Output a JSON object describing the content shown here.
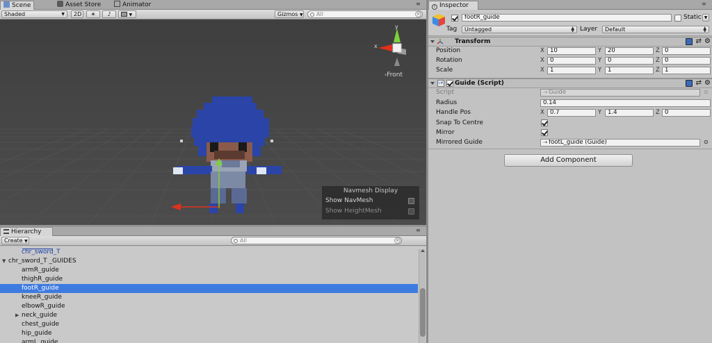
{
  "scene_tabs": {
    "scene": "Scene",
    "asset_store": "Asset Store",
    "animator": "Animator"
  },
  "scene_toolbar": {
    "draw_mode": "Shaded",
    "mode_2d": "2D",
    "gizmos": "Gizmos",
    "search_placeholder": "All"
  },
  "scene_view": {
    "gizmo_x": "x",
    "gizmo_y": "y",
    "view_label": "Front",
    "navmesh": {
      "title": "Navmesh Display",
      "show_navmesh": "Show NavMesh",
      "show_heightmesh": "Show HeightMesh"
    }
  },
  "hierarchy": {
    "tab": "Hierarchy",
    "create": "Create",
    "search_placeholder": "All",
    "items": [
      {
        "label": "chr_sword_T",
        "indent": 1,
        "arrow": "",
        "selected": false,
        "prefab": true
      },
      {
        "label": "chr_sword_T _GUIDES",
        "indent": 0,
        "arrow": "open",
        "selected": false,
        "prefab": false
      },
      {
        "label": "armR_guide",
        "indent": 1,
        "arrow": "",
        "selected": false,
        "prefab": false
      },
      {
        "label": "thighR_guide",
        "indent": 1,
        "arrow": "",
        "selected": false,
        "prefab": false
      },
      {
        "label": "footR_guide",
        "indent": 1,
        "arrow": "",
        "selected": true,
        "prefab": false
      },
      {
        "label": "kneeR_guide",
        "indent": 1,
        "arrow": "",
        "selected": false,
        "prefab": false
      },
      {
        "label": "elbowR_guide",
        "indent": 1,
        "arrow": "",
        "selected": false,
        "prefab": false
      },
      {
        "label": "neck_guide",
        "indent": 1,
        "arrow": "closed",
        "selected": false,
        "prefab": false
      },
      {
        "label": "chest_guide",
        "indent": 1,
        "arrow": "",
        "selected": false,
        "prefab": false
      },
      {
        "label": "hip_guide",
        "indent": 1,
        "arrow": "",
        "selected": false,
        "prefab": false
      },
      {
        "label": "armL_guide",
        "indent": 1,
        "arrow": "",
        "selected": false,
        "prefab": false
      }
    ]
  },
  "inspector": {
    "tab": "Inspector",
    "object_name": "footR_guide",
    "static_label": "Static",
    "tag_label": "Tag",
    "tag_value": "Untagged",
    "layer_label": "Layer",
    "layer_value": "Default",
    "transform": {
      "title": "Transform",
      "position_label": "Position",
      "rotation_label": "Rotation",
      "scale_label": "Scale",
      "position": {
        "x": "10",
        "y": "20",
        "z": "0"
      },
      "rotation": {
        "x": "0",
        "y": "0",
        "z": "0"
      },
      "scale": {
        "x": "1",
        "y": "1",
        "z": "1"
      }
    },
    "guide": {
      "title": "Guide (Script)",
      "script_label": "Script",
      "script_value": "Guide",
      "radius_label": "Radius",
      "radius_value": "0.14",
      "handle_pos_label": "Handle Pos",
      "handle_pos": {
        "x": "0.7",
        "y": "1.4",
        "z": "0"
      },
      "snap_label": "Snap To Centre",
      "mirror_label": "Mirror",
      "mirrored_guide_label": "Mirrored Guide",
      "mirrored_guide_value": "footL_guide (Guide)"
    },
    "axis_x": "X",
    "axis_y": "Y",
    "axis_z": "Z",
    "add_component": "Add Component"
  },
  "colors": {
    "selection": "#3e7be0",
    "scene_bg": "#474747",
    "helmet": "#2a44a8",
    "prefab_text": "#1a3ea6"
  }
}
